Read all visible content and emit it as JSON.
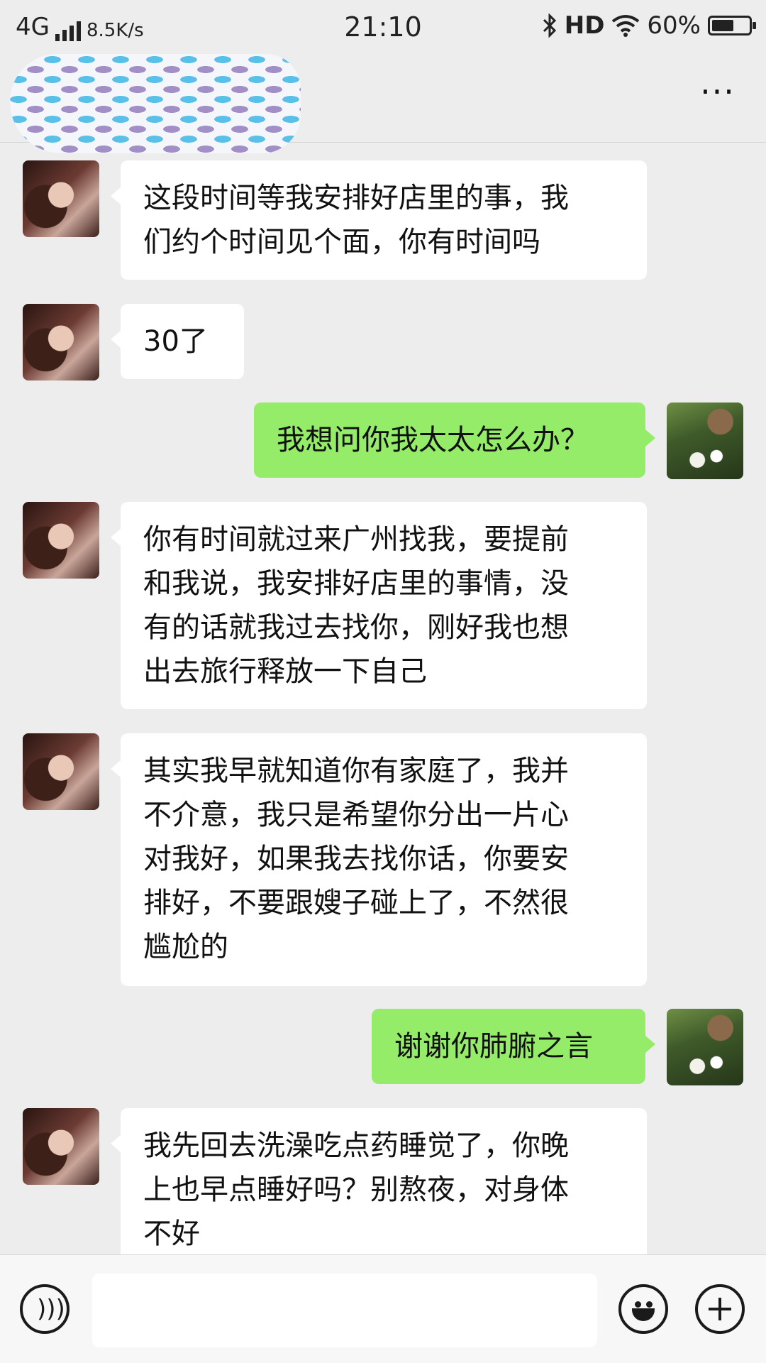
{
  "status_bar": {
    "network": "4G",
    "speed": "8.5K/s",
    "time": "21:10",
    "bluetooth_icon": "bluetooth-icon",
    "hd": "HD",
    "wifi_icon": "wifi-icon",
    "battery_percent": "60%",
    "battery_level": 0.6
  },
  "header": {
    "more_label": "···"
  },
  "messages": [
    {
      "side": "left",
      "text": "这段时间等我安排好店里的事，我\n们约个时间见个面，你有时间吗"
    },
    {
      "side": "left",
      "text": "30了"
    },
    {
      "side": "right",
      "text": "我想问你我太太怎么办？"
    },
    {
      "side": "left",
      "text": "你有时间就过来广州找我，要提前\n和我说，我安排好店里的事情，没\n有的话就我过去找你，刚好我也想\n出去旅行释放一下自己"
    },
    {
      "side": "left",
      "text": "其实我早就知道你有家庭了，我并\n不介意，我只是希望你分出一片心\n对我好，如果我去找你话，你要安\n排好，不要跟嫂子碰上了，不然很\n尴尬的"
    },
    {
      "side": "right",
      "text": "谢谢你肺腑之言"
    },
    {
      "side": "left",
      "text": "我先回去洗澡吃点药睡觉了，你晚\n上也早点睡好吗？别熬夜，对身体\n不好"
    }
  ],
  "input_bar": {
    "placeholder": "",
    "voice_icon": "voice-icon",
    "emoji_icon": "emoji-icon",
    "plus_icon": "plus-icon"
  },
  "colors": {
    "background": "#ededed",
    "bubble_received": "#ffffff",
    "bubble_sent": "#95ec69"
  }
}
